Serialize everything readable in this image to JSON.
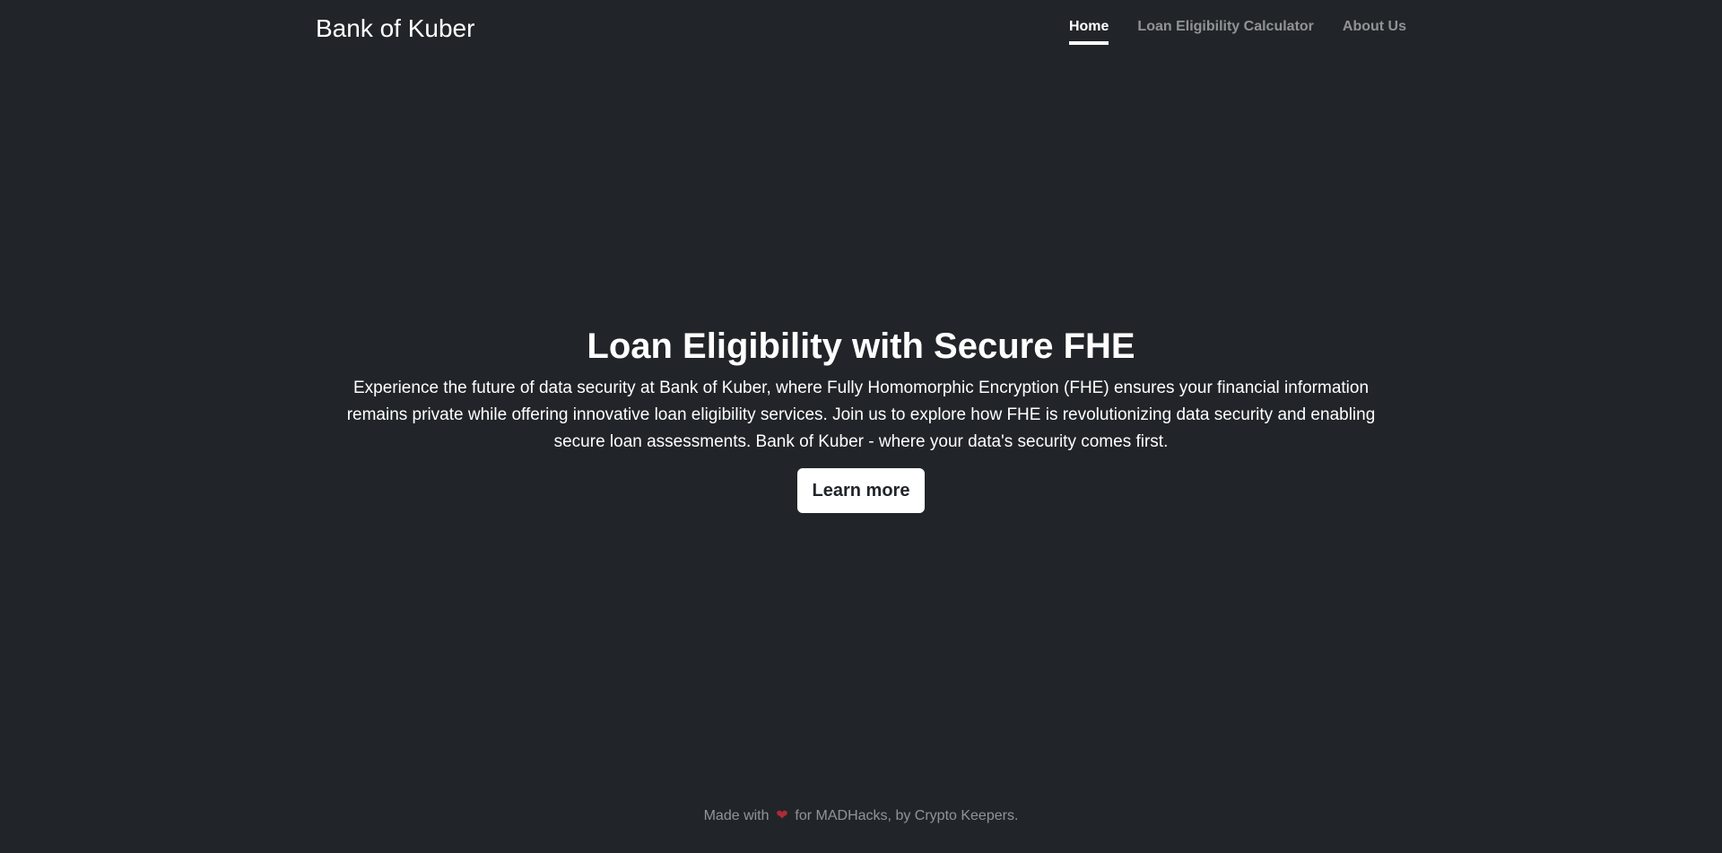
{
  "header": {
    "brand": "Bank of Kuber",
    "nav": [
      {
        "label": "Home",
        "active": true
      },
      {
        "label": "Loan Eligibility Calculator",
        "active": false
      },
      {
        "label": "About Us",
        "active": false
      }
    ]
  },
  "hero": {
    "title": "Loan Eligibility with Secure FHE",
    "lead": "Experience the future of data security at Bank of Kuber, where Fully Homomorphic Encryption (FHE) ensures your financial information remains private while offering innovative loan eligibility services. Join us to explore how FHE is revolutionizing data security and enabling secure loan assessments. Bank of Kuber - where your data's security comes first.",
    "button_label": "Learn more"
  },
  "footer": {
    "prefix": "Made with",
    "icon": "heart-icon",
    "suffix": "for MADHacks, by Crypto Keepers."
  },
  "colors": {
    "background": "#212529",
    "text": "#ffffff",
    "heart": "#b02a37"
  }
}
